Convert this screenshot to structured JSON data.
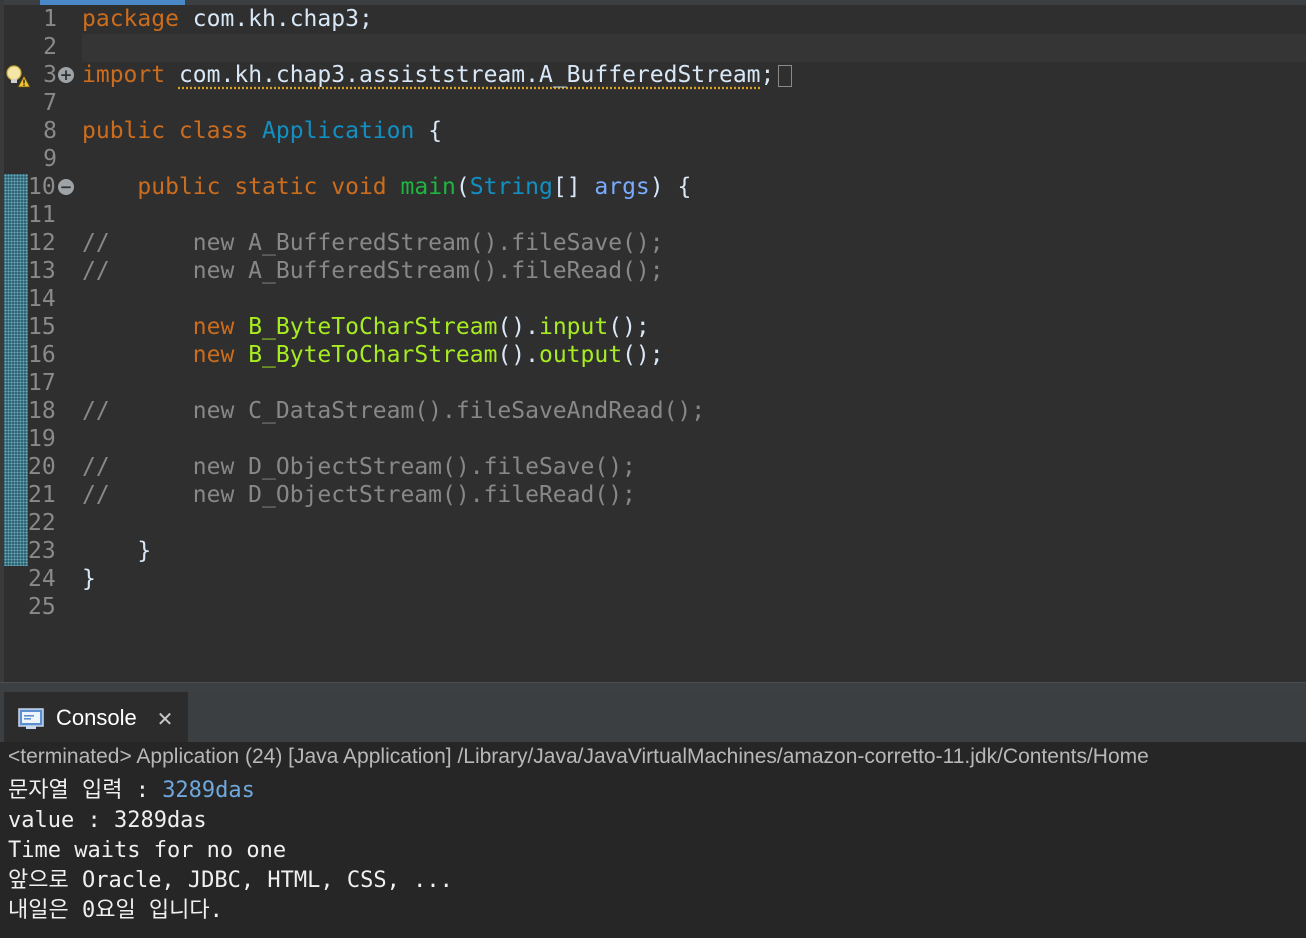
{
  "editor": {
    "lines": [
      {
        "n": "1",
        "parts": [
          {
            "t": "package",
            "c": "kw"
          },
          {
            "t": " com.kh.chap3;",
            "c": "plain"
          }
        ]
      },
      {
        "n": "2",
        "parts": []
      },
      {
        "n": "3",
        "fold": "+",
        "warning": true,
        "collapsed": true,
        "parts": [
          {
            "t": "import",
            "c": "kw"
          },
          {
            "t": " ",
            "c": "plain"
          },
          {
            "t": "com.kh.chap3.assiststream.A_BufferedStream",
            "c": "plain warn-underline"
          },
          {
            "t": ";",
            "c": "plain"
          }
        ]
      },
      {
        "n": "7",
        "parts": []
      },
      {
        "n": "8",
        "parts": [
          {
            "t": "public class",
            "c": "kw"
          },
          {
            "t": " ",
            "c": "plain"
          },
          {
            "t": "Application",
            "c": "cls"
          },
          {
            "t": " {",
            "c": "plain"
          }
        ]
      },
      {
        "n": "9",
        "parts": []
      },
      {
        "n": "10",
        "fold": "-",
        "parts": [
          {
            "t": "    public static void",
            "c": "kw"
          },
          {
            "t": " ",
            "c": "plain"
          },
          {
            "t": "main",
            "c": "mth"
          },
          {
            "t": "(",
            "c": "plain"
          },
          {
            "t": "String",
            "c": "cls"
          },
          {
            "t": "[] ",
            "c": "plain"
          },
          {
            "t": "args",
            "c": "prm"
          },
          {
            "t": ") {",
            "c": "plain"
          }
        ]
      },
      {
        "n": "11",
        "parts": []
      },
      {
        "n": "12",
        "parts": [
          {
            "t": "//      new A_BufferedStream().fileSave();",
            "c": "cmt"
          }
        ]
      },
      {
        "n": "13",
        "parts": [
          {
            "t": "//      new A_BufferedStream().fileRead();",
            "c": "cmt"
          }
        ]
      },
      {
        "n": "14",
        "parts": []
      },
      {
        "n": "15",
        "parts": [
          {
            "t": "        new",
            "c": "kw"
          },
          {
            "t": " ",
            "c": "plain"
          },
          {
            "t": "B_ByteToCharStream",
            "c": "yel"
          },
          {
            "t": "().",
            "c": "plain"
          },
          {
            "t": "input",
            "c": "yel"
          },
          {
            "t": "();",
            "c": "plain"
          }
        ]
      },
      {
        "n": "16",
        "parts": [
          {
            "t": "        new",
            "c": "kw"
          },
          {
            "t": " ",
            "c": "plain"
          },
          {
            "t": "B_ByteToCharStream",
            "c": "yel"
          },
          {
            "t": "().",
            "c": "plain"
          },
          {
            "t": "output",
            "c": "yel"
          },
          {
            "t": "();",
            "c": "plain"
          }
        ]
      },
      {
        "n": "17",
        "parts": []
      },
      {
        "n": "18",
        "parts": [
          {
            "t": "//      new C_DataStream().fileSaveAndRead();",
            "c": "cmt"
          }
        ]
      },
      {
        "n": "19",
        "parts": []
      },
      {
        "n": "20",
        "parts": [
          {
            "t": "//      new D_ObjectStream().fileSave();",
            "c": "cmt"
          }
        ]
      },
      {
        "n": "21",
        "parts": [
          {
            "t": "//      new D_ObjectStream().fileRead();",
            "c": "cmt"
          }
        ]
      },
      {
        "n": "22",
        "parts": []
      },
      {
        "n": "23",
        "parts": [
          {
            "t": "    }",
            "c": "plain"
          }
        ]
      },
      {
        "n": "24",
        "parts": [
          {
            "t": "}",
            "c": "plain"
          }
        ]
      },
      {
        "n": "25",
        "parts": []
      }
    ],
    "icons": {
      "warning": "warning-lightbulb-icon",
      "fold_expand": "fold-expand-icon",
      "fold_collapse": "fold-collapse-icon"
    }
  },
  "console": {
    "tab_label": "Console",
    "tab_icon": "console-icon",
    "close_icon": "close-icon",
    "status": "<terminated> Application (24) [Java Application] /Library/Java/JavaVirtualMachines/amazon-corretto-11.jdk/Contents/Home",
    "output": [
      {
        "prompt": "문자열 입력 : ",
        "input": "3289das"
      },
      {
        "prompt": "value : 3289das"
      },
      {
        "prompt": "Time waits for no one"
      },
      {
        "prompt": "앞으로 Oracle, JDBC, HTML, CSS, ..."
      },
      {
        "prompt": "내일은 0요일 입니다."
      }
    ]
  },
  "colors": {
    "keyword": "#cc6c1d",
    "class": "#1290c3",
    "method": "#1eb540",
    "param": "#79abff",
    "comment": "#888888",
    "highlight": "#a7ec21",
    "console_input": "#6fa8dc"
  }
}
